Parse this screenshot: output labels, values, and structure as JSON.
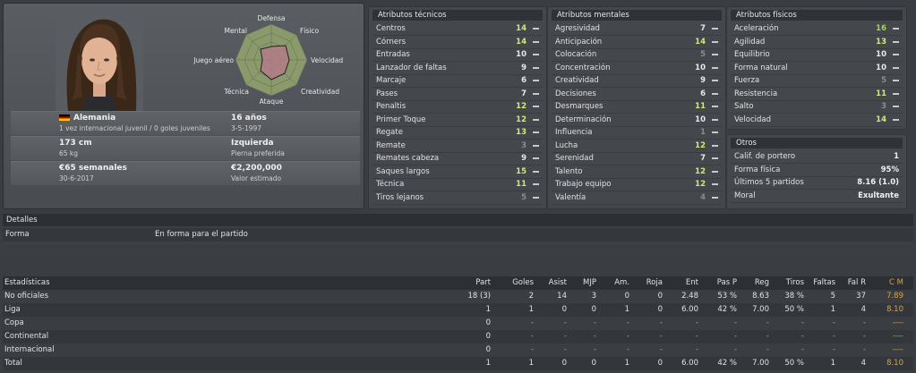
{
  "profile": {
    "radar_labels": {
      "defensa": "Defensa",
      "fisico": "Físico",
      "velocidad": "Velocidad",
      "creatividad": "Creatividad",
      "ataque": "Ataque",
      "tecnica": "Técnica",
      "juego_aereo": "Juego aéreo",
      "mental": "Mental"
    },
    "nationality": "Alemania",
    "caps": "1 vez internacional juvenil / 0 goles juveniles",
    "age": "16 años",
    "dob": "3-5-1997",
    "height": "173 cm",
    "weight": "65 kg",
    "foot": "Izquierda",
    "foot_label": "Pierna preferida",
    "wage": "€65 semanales",
    "contract_end": "30-6-2017",
    "value": "€2,200,000",
    "value_label": "Valor estimado",
    "flag_colors": [
      "#000000",
      "#dd0000",
      "#ffce00"
    ]
  },
  "tecnicos": {
    "title": "Atributos técnicos",
    "items": [
      {
        "label": "Centros",
        "value": "14",
        "tone": "hi"
      },
      {
        "label": "Córners",
        "value": "14",
        "tone": "hi"
      },
      {
        "label": "Entradas",
        "value": "10",
        "tone": "mid"
      },
      {
        "label": "Lanzador de faltas",
        "value": "9",
        "tone": "mid"
      },
      {
        "label": "Marcaje",
        "value": "6",
        "tone": "mid"
      },
      {
        "label": "Pases",
        "value": "7",
        "tone": "mid"
      },
      {
        "label": "Penaltis",
        "value": "12",
        "tone": "hi"
      },
      {
        "label": "Primer Toque",
        "value": "12",
        "tone": "hi"
      },
      {
        "label": "Regate",
        "value": "13",
        "tone": "hi"
      },
      {
        "label": "Remate",
        "value": "3",
        "tone": "lo"
      },
      {
        "label": "Remates cabeza",
        "value": "9",
        "tone": "mid"
      },
      {
        "label": "Saques largos",
        "value": "15",
        "tone": "hi"
      },
      {
        "label": "Técnica",
        "value": "11",
        "tone": "hi"
      },
      {
        "label": "Tiros lejanos",
        "value": "5",
        "tone": "lo"
      }
    ]
  },
  "mentales": {
    "title": "Atributos mentales",
    "items": [
      {
        "label": "Agresividad",
        "value": "7",
        "tone": "mid"
      },
      {
        "label": "Anticipación",
        "value": "14",
        "tone": "hi"
      },
      {
        "label": "Colocación",
        "value": "5",
        "tone": "lo"
      },
      {
        "label": "Concentración",
        "value": "10",
        "tone": "mid"
      },
      {
        "label": "Creatividad",
        "value": "9",
        "tone": "mid"
      },
      {
        "label": "Decisiones",
        "value": "6",
        "tone": "mid"
      },
      {
        "label": "Desmarques",
        "value": "11",
        "tone": "hi"
      },
      {
        "label": "Determinación",
        "value": "10",
        "tone": "mid"
      },
      {
        "label": "Influencia",
        "value": "1",
        "tone": "lo"
      },
      {
        "label": "Lucha",
        "value": "12",
        "tone": "hi"
      },
      {
        "label": "Serenidad",
        "value": "7",
        "tone": "mid"
      },
      {
        "label": "Talento",
        "value": "12",
        "tone": "hi"
      },
      {
        "label": "Trabajo equipo",
        "value": "12",
        "tone": "hi"
      },
      {
        "label": "Valentía",
        "value": "4",
        "tone": "lo"
      }
    ]
  },
  "fisicos": {
    "title": "Atributos físicos",
    "items": [
      {
        "label": "Aceleración",
        "value": "16",
        "tone": "green"
      },
      {
        "label": "Agilidad",
        "value": "13",
        "tone": "hi"
      },
      {
        "label": "Equilibrio",
        "value": "10",
        "tone": "mid"
      },
      {
        "label": "Forma natural",
        "value": "10",
        "tone": "mid"
      },
      {
        "label": "Fuerza",
        "value": "5",
        "tone": "lo"
      },
      {
        "label": "Resistencia",
        "value": "11",
        "tone": "hi"
      },
      {
        "label": "Salto",
        "value": "3",
        "tone": "lo"
      },
      {
        "label": "Velocidad",
        "value": "14",
        "tone": "hi"
      }
    ]
  },
  "otros": {
    "title": "Otros",
    "items": [
      {
        "label": "Calif. de portero",
        "value": "1"
      },
      {
        "label": "Forma física",
        "value": "95%"
      },
      {
        "label": "Últimos 5 partidos",
        "value": "8.16 (1.0)"
      },
      {
        "label": "Moral",
        "value": "Exultante"
      }
    ]
  },
  "detalles": {
    "title": "Detalles",
    "label": "Forma",
    "value": "En forma para el partido"
  },
  "stats": {
    "title": "Estadísticas",
    "columns": [
      "Part",
      "Goles",
      "Asist",
      "MJP",
      "Am.",
      "Roja",
      "Ent",
      "Pas P",
      "Reg",
      "Tiros",
      "Faltas",
      "Fal R",
      "C M"
    ],
    "rows": [
      {
        "name": "No oficiales",
        "cells": [
          "18 (3)",
          "2",
          "14",
          "3",
          "0",
          "0",
          "2.48",
          "53 %",
          "8.63",
          "38 %",
          "5",
          "37",
          "7.89"
        ]
      },
      {
        "name": "Liga",
        "cells": [
          "1",
          "1",
          "0",
          "0",
          "1",
          "0",
          "6.00",
          "42 %",
          "7.00",
          "50 %",
          "1",
          "4",
          "8.10"
        ]
      },
      {
        "name": "Copa",
        "cells": [
          "0",
          "-",
          "-",
          "-",
          "-",
          "-",
          "-",
          "-",
          "-",
          "-",
          "-",
          "-",
          "----"
        ]
      },
      {
        "name": "Continental",
        "cells": [
          "0",
          "-",
          "-",
          "-",
          "-",
          "-",
          "-",
          "-",
          "-",
          "-",
          "-",
          "-",
          "----"
        ]
      },
      {
        "name": "Internacional",
        "cells": [
          "0",
          "-",
          "-",
          "-",
          "-",
          "-",
          "-",
          "-",
          "-",
          "-",
          "-",
          "-",
          "----"
        ]
      },
      {
        "name": "Total",
        "cells": [
          "1",
          "1",
          "0",
          "0",
          "1",
          "0",
          "6.00",
          "42 %",
          "7.00",
          "50 %",
          "1",
          "4",
          "8.10"
        ]
      }
    ]
  }
}
